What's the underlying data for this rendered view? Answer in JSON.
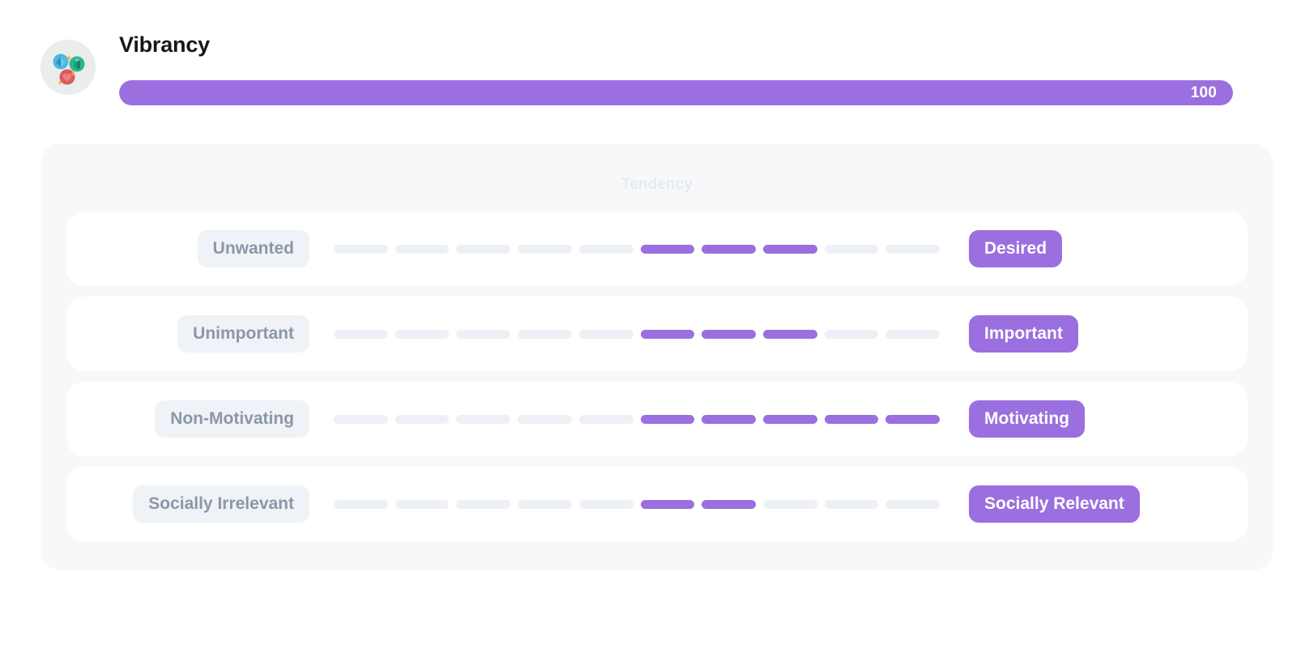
{
  "header": {
    "avatar_icon": "vibrancy-shapes-icon",
    "title": "Vibrancy",
    "progress": {
      "value": "100",
      "percent": 100,
      "fill_color": "#9b6fdf",
      "track_color": "#edeef2"
    }
  },
  "panel": {
    "heading": "Tendency",
    "background_color": "#f7f8fa",
    "segment_count": 10,
    "segment_on_color": "#9b6fdf",
    "segment_off_color": "#edf1f5",
    "rows": [
      {
        "left_label": "Unwanted",
        "right_label": "Desired",
        "filled_from": 6,
        "filled_to": 8,
        "filled_count": 3
      },
      {
        "left_label": "Unimportant",
        "right_label": "Important",
        "filled_from": 6,
        "filled_to": 8,
        "filled_count": 3
      },
      {
        "left_label": "Non-Motivating",
        "right_label": "Motivating",
        "filled_from": 6,
        "filled_to": 10,
        "filled_count": 5
      },
      {
        "left_label": "Socially Irrelevant",
        "right_label": "Socially Relevant",
        "filled_from": 6,
        "filled_to": 7,
        "filled_count": 2
      }
    ]
  }
}
